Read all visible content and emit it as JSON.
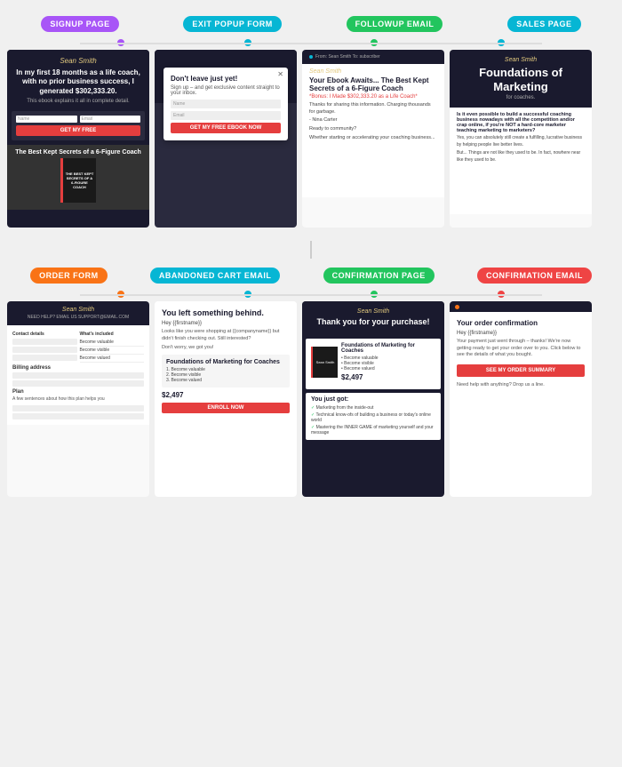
{
  "top_labels": {
    "signup": "SIGNUP PAGE",
    "exit_popup": "EXIT POPUP FORM",
    "followup": "FOLLOWUP EMAIL",
    "sales": "SALES PAGE"
  },
  "bottom_labels": {
    "order_form": "ORDER FORM",
    "abandoned_cart": "ABANDONED CART EMAIL",
    "confirmation_page": "CONFIRMATION PAGE",
    "confirmation_email": "CONFIRMATION EMAIL"
  },
  "signup_card": {
    "brand": "Sean Smith",
    "headline": "In my first 18 months as a life coach, with no prior business success, I generated $302,333.20.",
    "subtext": "This ebook explains it all in complete detail.",
    "field1_placeholder": "Name",
    "field2_placeholder": "Email",
    "cta": "GET MY FREE",
    "book_title": "The Best Kept Secrets of a 6-Figure Coach",
    "book_subtitle": "THE BEST KEPT SECRETS OF A 6-FIGURE COACH"
  },
  "exit_popup_card": {
    "title": "Don't leave just yet!",
    "subtitle": "Sign up – and get exclusive content straight to your inbox.",
    "field1_placeholder": "Name",
    "field2_placeholder": "Email",
    "cta": "GET MY FREE EBOOK NOW"
  },
  "followup_email_card": {
    "brand": "Sean Smith",
    "ebook_title": "Your Ebook Awaits...\nThe Best Kept Secrets of a 6-Figure Coach",
    "red_text": "*Bonus: I Made $302,333.20\nas a Life Coach*",
    "body1": "Thanks for sharing this information. Charging thousands for garbage.",
    "body2": "- Nina Carter",
    "body3": "Ready to community?",
    "body4": "Whether starting or accelerating your coaching business..."
  },
  "sales_page_card": {
    "brand": "Sean Smith",
    "title": "Foundations of Marketing",
    "subtitle": "for coaches.",
    "body1": "Is it even possible to build a successful coaching business nowadays with all the competition and/or crap online, if you're NOT a hard-core marketer teaching marketing to marketers?",
    "body2": "Yes, you can absolutely still create a fulfilling, lucrative business by helping people live better lives.",
    "body3": "But... Things are not like they used to be. In fact, nowhere near like they used to be."
  },
  "order_form_card": {
    "brand": "Sean Smith",
    "support_text": "NEED HELP? EMAIL US SUPPORT@EMAIL.COM",
    "contact_label": "Contact details",
    "whats_included_label": "What's included",
    "included_items": [
      "Become valuable",
      "Become visible",
      "Become valued"
    ],
    "billing_label": "Billing address",
    "plan_label": "Plan",
    "plan_text": "A few sentences about how this plan helps you"
  },
  "abandoned_cart_card": {
    "headline": "You left something behind.",
    "greeting": "Hey {{firstname}}",
    "body1": "Looks like you were shopping at {{companyname}} but didn't finish checking out. Still interested?",
    "body2": "Don't worry, we got you!",
    "product_title": "Foundations of Marketing for Coaches",
    "product_items": [
      "Become valuable",
      "Become visible",
      "Become valued"
    ],
    "price": "$2,497",
    "cta": "ENROLL NOW"
  },
  "confirmation_page_card": {
    "brand": "Sean Smith",
    "headline": "Thank you for your purchase!",
    "product_name": "Foundations of Marketing for Coaches",
    "product_items": [
      "Become valuable",
      "Become visible",
      "Become valued"
    ],
    "price": "$2,497",
    "you_got_title": "You just got:",
    "you_got_items": [
      "Marketing from the inside-out",
      "Technical know-ofs of building a business or today's online world",
      "Mastering the INNER GAME of marketing yourself and your message"
    ]
  },
  "confirmation_email_card": {
    "title": "Your order confirmation",
    "greeting": "Hey {{firstname}}",
    "body": "Your payment just went through – thanks! We're now getting ready to get your order over to you. Click below to see the details of what you bought.",
    "cta": "SEE MY ORDER SUMMARY",
    "help_text": "Need help with anything? Drop us a line."
  }
}
